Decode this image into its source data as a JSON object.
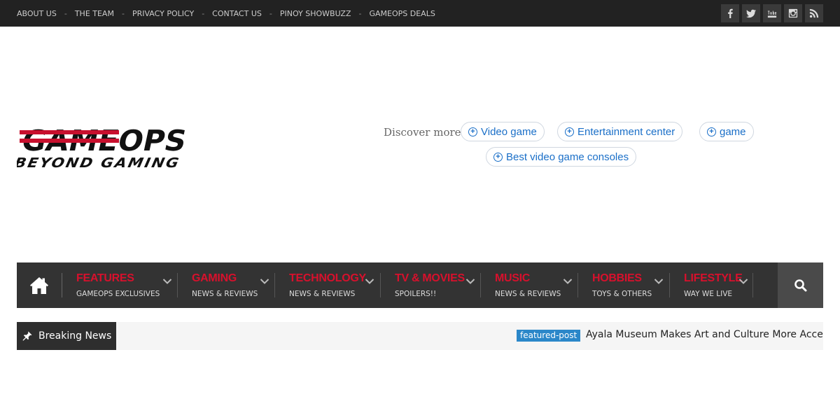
{
  "topbar": {
    "links": [
      "ABOUT US",
      "THE TEAM",
      "PRIVACY POLICY",
      "CONTACT US",
      "PINOY SHOWBUZZ",
      "GAMEOPS DEALS"
    ],
    "separator": "-",
    "social_icons": [
      "facebook-icon",
      "twitter-icon",
      "youtube-icon",
      "instagram-icon",
      "rss-icon"
    ]
  },
  "logo": {
    "line1": "GAMEOPS",
    "line2": "BEYOND GAMING",
    "colors": {
      "red": "#c8102e",
      "black": "#111111"
    }
  },
  "discover": {
    "label": "Discover more",
    "chips": [
      "Video game",
      "Entertainment center",
      "game",
      "Best video game consoles"
    ]
  },
  "nav": {
    "items": [
      {
        "title": "FEATURES",
        "sub": "GAMEOPS EXCLUSIVES"
      },
      {
        "title": "GAMING",
        "sub": "NEWS & REVIEWS"
      },
      {
        "title": "TECHNOLOGY",
        "sub": "NEWS & REVIEWS"
      },
      {
        "title": "TV & MOVIES",
        "sub": "SPOILERS!!"
      },
      {
        "title": "MUSIC",
        "sub": "NEWS & REVIEWS"
      },
      {
        "title": "HOBBIES",
        "sub": "TOYS & OTHERS"
      },
      {
        "title": "LIFESTYLE",
        "sub": "WAY WE LIVE"
      }
    ],
    "accent": "#d8102c"
  },
  "breaking": {
    "label": "Breaking News",
    "tag": "featured-post",
    "headline": "Ayala Museum Makes Art and Culture More Accessible"
  }
}
